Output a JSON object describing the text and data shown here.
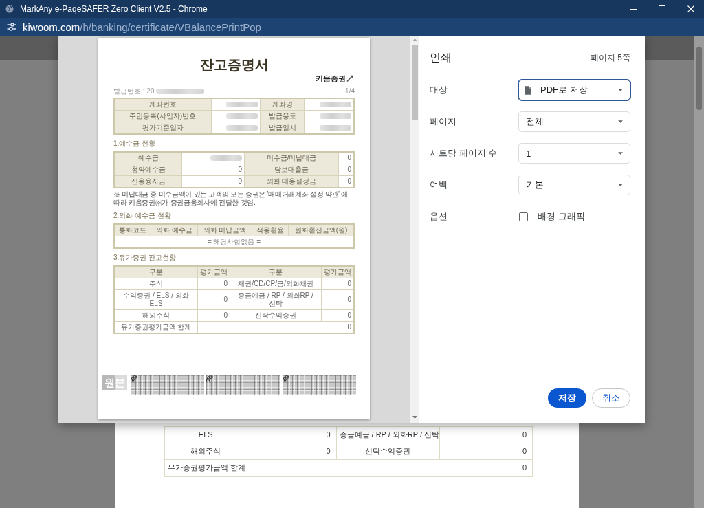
{
  "window": {
    "title": "MarkAny e-PaqeSAFER Zero Client V2.5 - Chrome"
  },
  "address_bar": {
    "domain": "kiwoom.com",
    "path": "/h/banking/certificate/VBalancePrintPop"
  },
  "background_page": {
    "table": {
      "rows": [
        [
          {
            "kind": "label",
            "text": "ELS"
          },
          {
            "kind": "value",
            "text": "0"
          },
          {
            "kind": "label",
            "text": "증금예금 / RP / 외화RP / 신탁"
          },
          {
            "kind": "value",
            "text": "0"
          }
        ],
        [
          {
            "kind": "label",
            "text": "해외주식"
          },
          {
            "kind": "value",
            "text": "0"
          },
          {
            "kind": "label",
            "text": "신탁수익증권"
          },
          {
            "kind": "value",
            "text": "0"
          }
        ],
        [
          {
            "kind": "label",
            "text": "유가증권평가금액 합계"
          },
          {
            "kind": "value",
            "text": "0",
            "colspan": 3
          }
        ]
      ]
    }
  },
  "print_preview": {
    "title": "잔고증명서",
    "logo": "키움증권",
    "issue_number": {
      "text": "발급번호 : 20",
      "redacted": true
    },
    "page_number": "1/4",
    "sections": [
      {
        "table": {
          "rows": [
            [
              {
                "kind": "head",
                "text": "계좌번호"
              },
              {
                "kind": "redacted"
              },
              {
                "kind": "head",
                "text": "계좌명"
              },
              {
                "kind": "redacted"
              }
            ],
            [
              {
                "kind": "head",
                "text": "주민등록(사업자)번호"
              },
              {
                "kind": "redacted"
              },
              {
                "kind": "head",
                "text": "발급용도"
              },
              {
                "kind": "redacted"
              }
            ],
            [
              {
                "kind": "head",
                "text": "평가기준일자"
              },
              {
                "kind": "redacted"
              },
              {
                "kind": "head",
                "text": "발급일시"
              },
              {
                "kind": "redacted"
              }
            ]
          ]
        }
      },
      {
        "title": "1.예수금 현황",
        "table": {
          "rows": [
            [
              {
                "kind": "head",
                "text": "예수금"
              },
              {
                "kind": "redacted"
              },
              {
                "kind": "head",
                "text": "미수금/미납대금"
              },
              {
                "kind": "value",
                "text": "0"
              }
            ],
            [
              {
                "kind": "head",
                "text": "청약예수금"
              },
              {
                "kind": "value",
                "text": "0"
              },
              {
                "kind": "head",
                "text": "담보대출금"
              },
              {
                "kind": "value",
                "text": "0"
              }
            ],
            [
              {
                "kind": "head",
                "text": "신용융자금"
              },
              {
                "kind": "value",
                "text": "0"
              },
              {
                "kind": "head",
                "text": "외화 대용설정금"
              },
              {
                "kind": "value",
                "text": "0"
              }
            ]
          ]
        },
        "note": "※ 미납대금 중 미수금액이 있는 고객의 모든 증권은 '매매거래계좌 설정 약관' 에 따라 키움증권㈜가 증권금융회사에 전달한 것임."
      },
      {
        "title": "2.외화 예수금 현황",
        "table": {
          "rows": [
            [
              {
                "kind": "head",
                "text": "통화코드"
              },
              {
                "kind": "head",
                "text": "외화 예수금"
              },
              {
                "kind": "head",
                "text": "외화 미납금액"
              },
              {
                "kind": "head",
                "text": "적용환율"
              },
              {
                "kind": "head",
                "text": "원화환산금액(원)"
              }
            ],
            [
              {
                "kind": "note",
                "text": "= 해당사항없음 =",
                "colspan": 5
              }
            ]
          ]
        }
      },
      {
        "title": "3.유가증권 잔고현황",
        "table": {
          "rows": [
            [
              {
                "kind": "head",
                "text": "구분"
              },
              {
                "kind": "head",
                "text": "평가금액"
              },
              {
                "kind": "head",
                "text": "구분"
              },
              {
                "kind": "head",
                "text": "평가금액"
              }
            ],
            [
              {
                "kind": "label",
                "text": "주식"
              },
              {
                "kind": "value",
                "text": "0"
              },
              {
                "kind": "label",
                "text": "채권/CD/CP/금/외화채권"
              },
              {
                "kind": "value",
                "text": "0"
              }
            ],
            [
              {
                "kind": "label",
                "text": "수익증권 / ELS / 외화 ELS"
              },
              {
                "kind": "value",
                "text": "0"
              },
              {
                "kind": "label",
                "text": "증금예금 / RP / 외화RP / 신탁"
              },
              {
                "kind": "value",
                "text": "0"
              }
            ],
            [
              {
                "kind": "label",
                "text": "해외주식"
              },
              {
                "kind": "value",
                "text": "0"
              },
              {
                "kind": "label",
                "text": "신탁수익증권"
              },
              {
                "kind": "value",
                "text": "0"
              }
            ],
            [
              {
                "kind": "label",
                "text": "유가증권평가금액 합계"
              },
              {
                "kind": "value",
                "text": "0",
                "colspan": 3
              }
            ]
          ]
        }
      }
    ],
    "stamp": "원본"
  },
  "print_dialog": {
    "title": "인쇄",
    "page_count": "페이지 5쪽",
    "settings": [
      {
        "kind": "destination",
        "label": "대상",
        "value": "PDF로 저장",
        "focused": true
      },
      {
        "kind": "select",
        "label": "페이지",
        "value": "전체",
        "focused": false
      },
      {
        "kind": "select",
        "label": "시트당 페이지 수",
        "value": "1",
        "focused": false
      },
      {
        "kind": "select",
        "label": "여백",
        "value": "기본",
        "focused": false
      },
      {
        "kind": "checkbox",
        "label": "옵션",
        "option": "배경 그래픽",
        "checked": false
      }
    ],
    "buttons": [
      {
        "label": "저장",
        "primary": true
      },
      {
        "label": "취소",
        "primary": false
      }
    ]
  }
}
